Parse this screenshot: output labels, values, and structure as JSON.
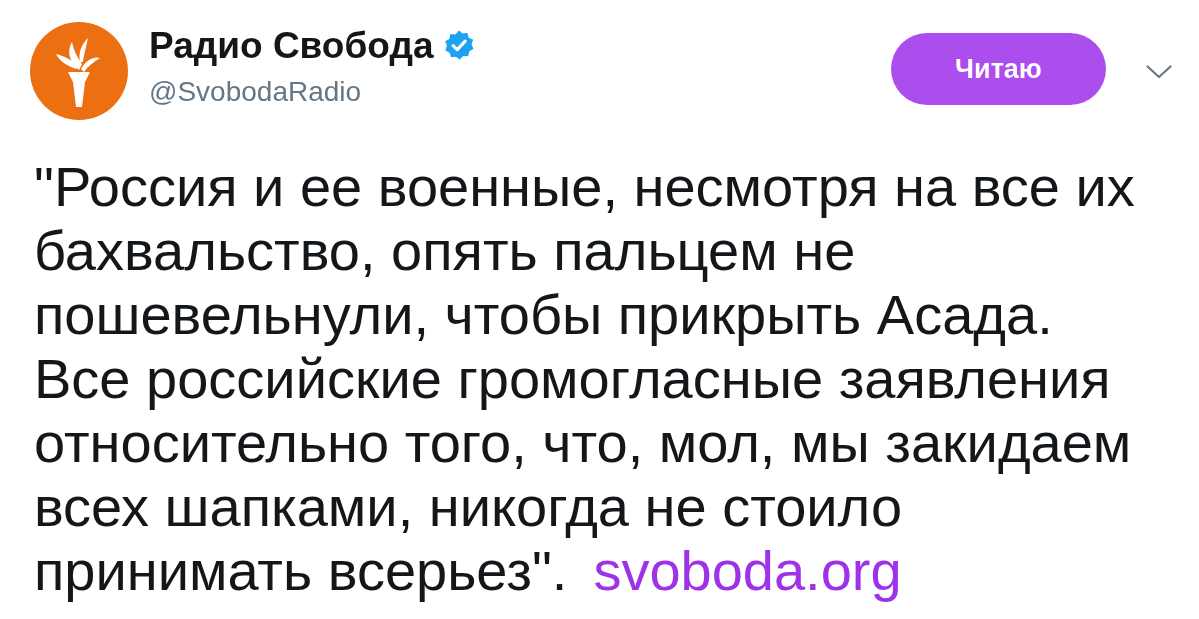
{
  "account": {
    "name": "Радио Свобода",
    "verified": true,
    "handle": "@SvobodaRadio"
  },
  "follow_button": {
    "label": "Читаю",
    "selected": true
  },
  "tweet": {
    "lines": [
      "\"Россия и ее военные, несмотря на все их",
      "бахвальство, опять пальцем не",
      "пошевельнули, чтобы прикрыть Асада.",
      "Все российские громогласные заявления",
      "относительно того, что, мол, мы закидаем",
      "всех шапками, никогда не стоило",
      "принимать всерьез\"."
    ],
    "link": "svoboda.org"
  }
}
